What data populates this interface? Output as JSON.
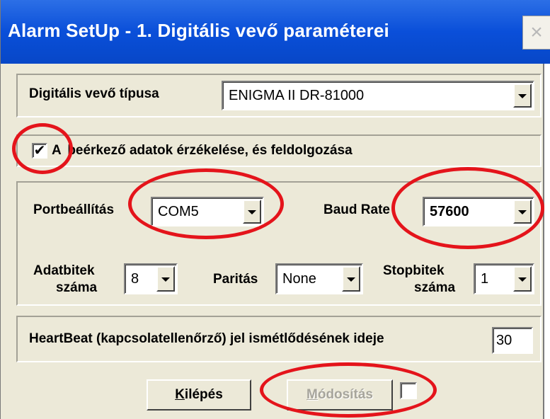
{
  "window": {
    "title": "Alarm SetUp - 1. Digitális vevő paraméterei",
    "close_glyph": "×"
  },
  "receiver": {
    "type_label": "Digitális vevő típusa",
    "type_value": "ENIGMA II DR-81000"
  },
  "processing": {
    "checked": true,
    "check_glyph": "✔",
    "label_prefix": "A",
    "label_rest": "beérkező adatok érzékelése, és feldolgozása"
  },
  "port_settings": {
    "port_label": "Portbeállítás",
    "port_value": "COM5",
    "baud_label": "Baud Rate",
    "baud_value": "57600",
    "databits_label_1": "Adatbitek",
    "databits_label_2": "száma",
    "databits_value": "8",
    "parity_label": "Paritás",
    "parity_value": "None",
    "stopbits_label_1": "Stopbitek",
    "stopbits_label_2": "száma",
    "stopbits_value": "1"
  },
  "heartbeat": {
    "label": "HeartBeat (kapcsolatellenőrző) jel ismétlődésének ideje",
    "value": "30"
  },
  "buttons": {
    "exit_hotkey": "K",
    "exit_rest": "ilépés",
    "modify_hotkey": "M",
    "modify_rest": "ódosítás",
    "modify_enabled": false,
    "modify_checkbox_checked": false
  },
  "annotations": {
    "marker_color": "#e4141b",
    "marker_shape": "red-ellipse"
  }
}
